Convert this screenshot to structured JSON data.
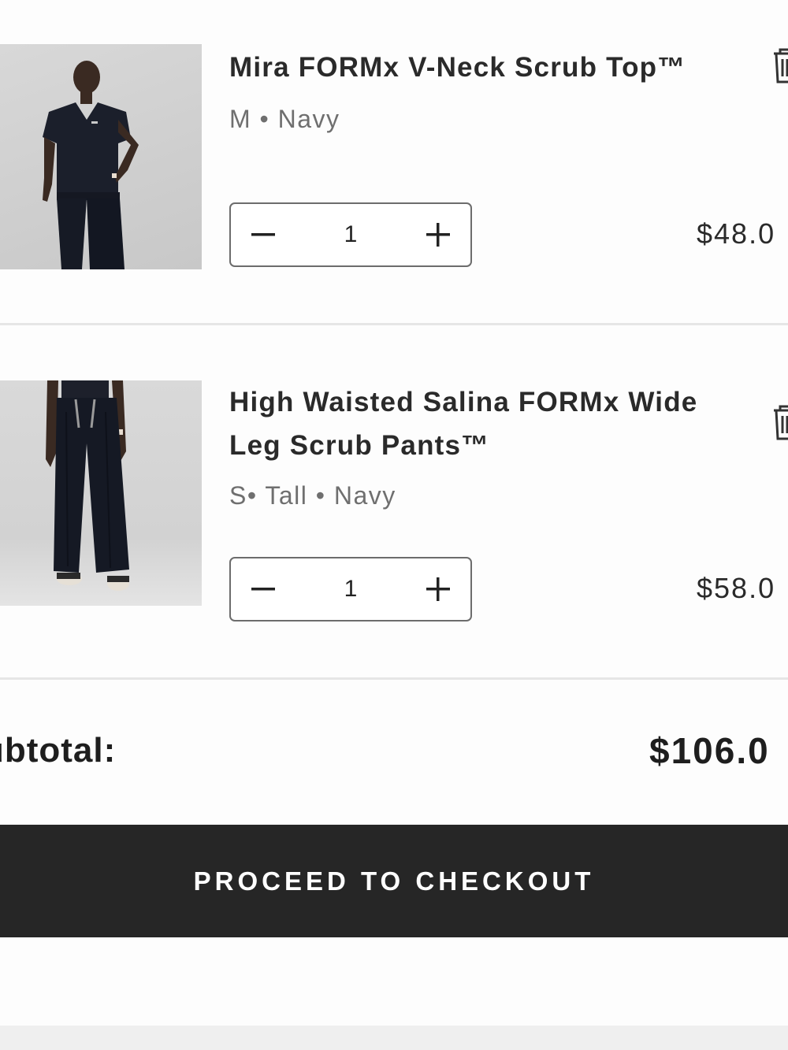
{
  "cart": {
    "items": [
      {
        "name": "Mira FORMx V-Neck Scrub Top™",
        "variant": "M • Navy",
        "quantity": "1",
        "price": "$48.0",
        "image_icon": "product-photo-scrub-top"
      },
      {
        "name": "High Waisted Salina FORMx Wide Leg Scrub Pants™",
        "variant": "S• Tall • Navy",
        "quantity": "1",
        "price": "$58.0",
        "image_icon": "product-photo-scrub-pants"
      }
    ],
    "subtotal_label": "ubtotal:",
    "subtotal_value": "$106.0",
    "checkout_label": "PROCEED TO CHECKOUT"
  },
  "colors": {
    "checkout_bg": "#262626",
    "checkout_text": "#ffffff",
    "muted_text": "#6f6f6f",
    "divider": "#e6e6e6",
    "navy_garment": "#1b1f2b"
  },
  "icons": {
    "remove": "trash-icon",
    "decrease": "minus-icon",
    "increase": "plus-icon"
  }
}
